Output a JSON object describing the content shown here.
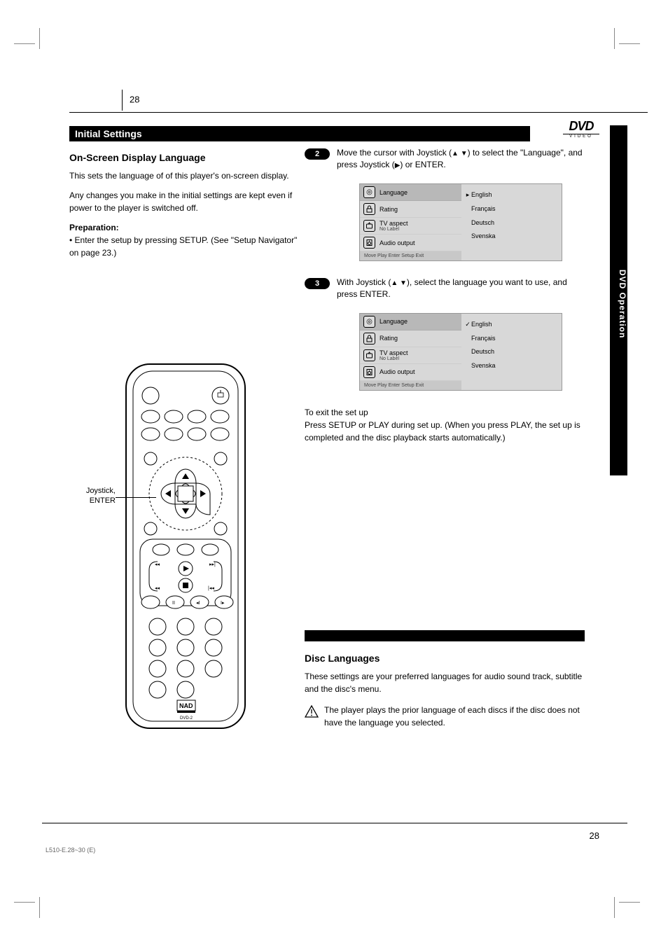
{
  "page_number_top": "28",
  "page_number_bottom": "28",
  "title_bar": "Initial Settings",
  "side_tab": "DVD Operation",
  "dvd_logo": {
    "top": "DVD",
    "bottom": "VIDEO"
  },
  "left": {
    "heading": "On-Screen Display Language",
    "p1_a": "This sets the language of of this player's on-screen display.",
    "p1_b": "Any changes you make in the initial settings are kept even if power to the player is switched off.",
    "prep_head": "Preparation:",
    "prep_body": "• Enter the setup by pressing SETUP. (See \"Setup Navigator\" on page 23.)"
  },
  "steps": {
    "s2_num": "2",
    "s2_a": "Move the cursor with Joystick (",
    "s2_b": ") to select the \"Language\", and press Joystick (",
    "s2_c": ") or ENTER.",
    "s3_num": "3",
    "s3_a": "With Joystick (",
    "s3_b": "), select the language you want to use, and press ENTER."
  },
  "menu1": {
    "rows": [
      {
        "icon": "◎",
        "label": "Language",
        "active": true
      },
      {
        "icon": "lock",
        "label": "Rating"
      },
      {
        "icon": "tv",
        "label": "TV aspect",
        "nolabel": "No Label"
      },
      {
        "icon": "speaker",
        "label": "Audio output"
      }
    ],
    "bottom": "Move   Play  Enter   Setup  Exit",
    "right": [
      {
        "mark": "▸",
        "text": "English"
      },
      {
        "mark": "",
        "text": "Français"
      },
      {
        "mark": "",
        "text": "Deutsch"
      },
      {
        "mark": "",
        "text": "Svenska"
      }
    ]
  },
  "menu2": {
    "rows": [
      {
        "icon": "◎",
        "label": "Language",
        "active": true
      },
      {
        "icon": "lock",
        "label": "Rating"
      },
      {
        "icon": "tv",
        "label": "TV aspect",
        "nolabel": "No Label"
      },
      {
        "icon": "speaker",
        "label": "Audio output"
      }
    ],
    "bottom": "Move   Play  Enter   Setup  Exit",
    "right": [
      {
        "mark": "✓",
        "text": "English"
      },
      {
        "mark": "",
        "text": "Français"
      },
      {
        "mark": "",
        "text": "Deutsch"
      },
      {
        "mark": "",
        "text": "Svenska"
      }
    ]
  },
  "exit": {
    "head": "To exit the set up",
    "body": "Press SETUP or PLAY during set up. (When you press PLAY, the set up is completed and the disc playback starts automatically.)"
  },
  "lang": {
    "heading": "Disc Languages",
    "p1": "These settings are your preferred languages for audio sound track, subtitle and the disc's menu.",
    "caution": "The player plays the prior language of each discs if the disc does not have the language you selected."
  },
  "remote_label": "Joystick, ENTER",
  "remote_brand": "NAD",
  "remote_model": "DVD-2",
  "footerline": "L510-E.28~30  (E)"
}
